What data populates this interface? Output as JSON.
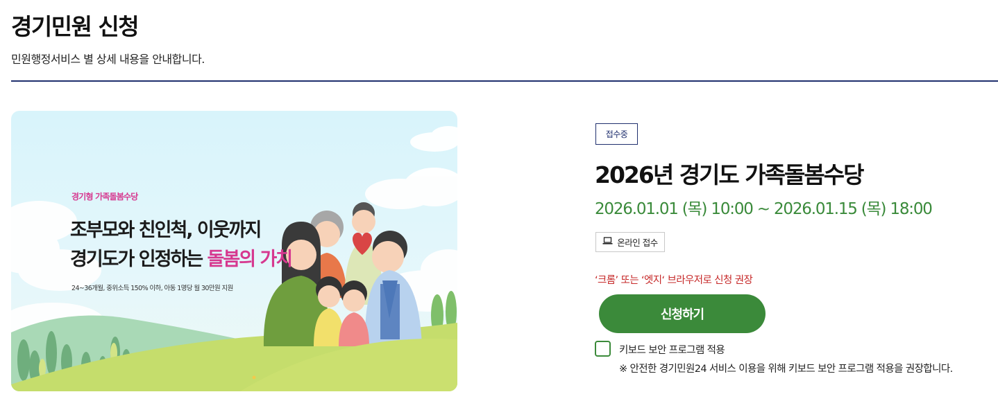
{
  "header": {
    "title": "경기민원 신청",
    "description": "민원행정서비스 별 상세 내용을 안내합니다."
  },
  "banner": {
    "tag": "경기형 가족돌봄수당",
    "line1": "조부모와 친인척, 이웃까지",
    "line2_main": "경기도가 인정하는 ",
    "line2_highlight": "돌봄의 가치",
    "subtext": "24~36개월, 중위소득 150% 이하, 아동 1명당 월 30만원 지원"
  },
  "service": {
    "status": "접수중",
    "title": "2026년 경기도 가족돌봄수당",
    "period": "2026.01.01 (목) 10:00 ~ 2026.01.15 (목) 18:00",
    "channel": "온라인 접수",
    "channel_icon": "laptop-icon",
    "browser_note": "‘크롬’ 또는 ‘엣지‘ 브라우저로 신청 권장",
    "apply_label": "신청하기",
    "keyboard_security": {
      "label": "키보드 보안 프로그램 적용",
      "checked": false,
      "note": "※ 안전한 경기민원24 서비스 이용을 위해 키보드 보안 프로그램 적용을 권장합니다."
    }
  },
  "colors": {
    "accent_green": "#3b8a3a",
    "navy": "#1f2f6e",
    "warning_red": "#c62828",
    "banner_pink": "#d6388f"
  }
}
